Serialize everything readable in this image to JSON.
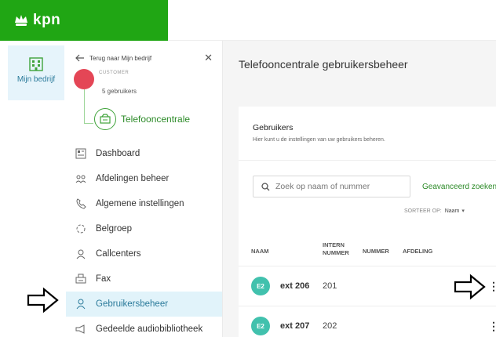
{
  "brand": {
    "name": "kpn",
    "color": "#20a614"
  },
  "rail": {
    "label": "Mijn bedrijf",
    "icon": "building-icon"
  },
  "panel": {
    "back_label": "Terug naar Mijn bedrijf",
    "customer_label": "CUSTOMER",
    "customer_users": "5 gebruikers",
    "customer_color": "#e44656",
    "section": "Telefooncentrale",
    "menu": [
      {
        "label": "Dashboard",
        "icon": "dashboard-icon"
      },
      {
        "label": "Afdelingen beheer",
        "icon": "departments-icon"
      },
      {
        "label": "Algemene instellingen",
        "icon": "phone-settings-icon"
      },
      {
        "label": "Belgroep",
        "icon": "call-group-icon"
      },
      {
        "label": "Callcenters",
        "icon": "headset-icon"
      },
      {
        "label": "Fax",
        "icon": "fax-icon"
      },
      {
        "label": "Gebruikersbeheer",
        "icon": "user-icon",
        "active": true
      },
      {
        "label": "Gedeelde audiobibliotheek",
        "icon": "megaphone-icon"
      }
    ]
  },
  "main": {
    "title": "Telefooncentrale gebruikersbeheer",
    "card_title": "Gebruikers",
    "card_subtitle": "Hier kunt u de instellingen van uw gebruikers beheren.",
    "search_placeholder": "Zoek op naam of nummer",
    "advanced_search": "Geavanceerd zoeken",
    "sort_label": "SORTEER OP:",
    "sort_value": "Naam",
    "columns": {
      "naam": "NAAM",
      "intern_1": "INTERN",
      "intern_2": "NUMMER",
      "nummer": "NUMMER",
      "afdeling": "AFDELING"
    },
    "rows": [
      {
        "initials": "E2",
        "name": "ext 206",
        "intern": "201"
      },
      {
        "initials": "E2",
        "name": "ext 207",
        "intern": "202"
      }
    ],
    "accent": "#2b8a27",
    "avatar_color": "#41c1ad"
  }
}
